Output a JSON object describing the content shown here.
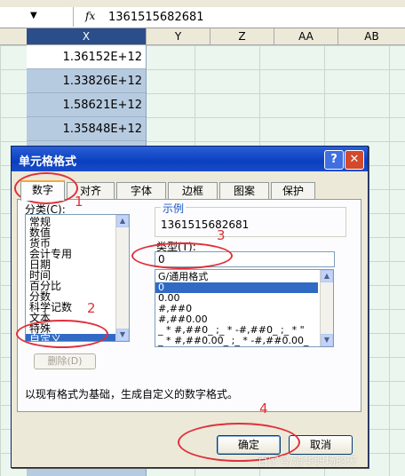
{
  "formula_bar": {
    "fx": "fx",
    "value": "1361515682681"
  },
  "columns": [
    "X",
    "Y",
    "Z",
    "AA",
    "AB"
  ],
  "cells": [
    "1.36152E+12",
    "1.33826E+12",
    "1.58621E+12",
    "1.35848E+12"
  ],
  "dialog": {
    "title": "单元格格式",
    "help_icon": "question-icon",
    "close_icon": "close-icon",
    "tabs": [
      "数字",
      "对齐",
      "字体",
      "边框",
      "图案",
      "保护"
    ],
    "category_label": "分类(C):",
    "categories": [
      "常规",
      "数值",
      "货币",
      "会计专用",
      "日期",
      "时间",
      "百分比",
      "分数",
      "科学记数",
      "文本",
      "特殊",
      "自定义"
    ],
    "selected_category": "自定义",
    "delete_button": "删除(D)",
    "sample_label": "示例",
    "sample_value": "1361515682681",
    "type_label": "类型(T):",
    "type_value": "0",
    "formats": [
      "G/通用格式",
      "0",
      "0.00",
      "#,##0",
      "#,##0.00",
      "_ * #,##0_ ;_ * -#,##0_ ;_ * \"",
      "_ * #,##0.00_ ;_ * -#,##0.00_"
    ],
    "selected_format": "0",
    "description": "以现有格式为基础，生成自定义的数字格式。",
    "ok_button": "确定",
    "cancel_button": "取消"
  },
  "annotations": [
    "1",
    "2",
    "3",
    "4"
  ],
  "annotation_color": "#e0303a",
  "selection_color": "#316ac5",
  "watermark": "百家号/清华职场的天"
}
